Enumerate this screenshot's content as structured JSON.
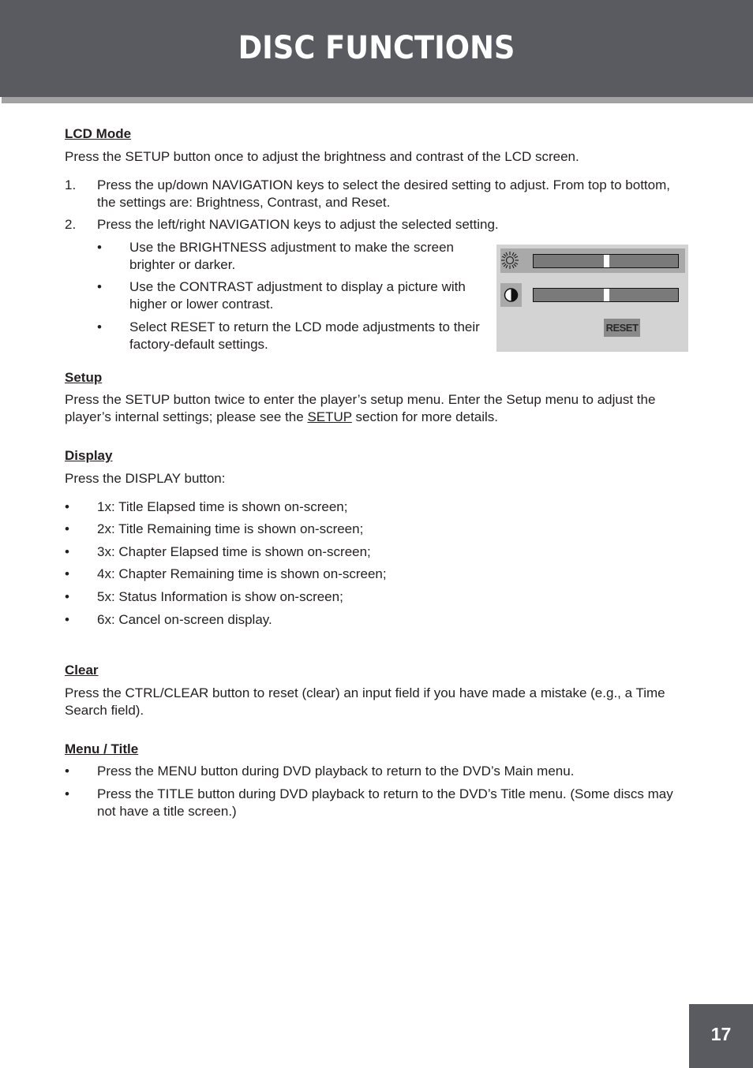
{
  "header": {
    "title": "DISC FUNCTIONS"
  },
  "lcd_mode": {
    "heading": "LCD Mode",
    "intro": "Press the SETUP button once to adjust the brightness and contrast of the LCD screen.",
    "steps": [
      {
        "num": "1.",
        "text": "Press the up/down NAVIGATION keys to select the desired setting to adjust. From top to bottom, the settings are: Brightness, Contrast, and Reset."
      },
      {
        "num": "2.",
        "text": "Press the left/right NAVIGATION keys to adjust the selected setting."
      }
    ],
    "bullets": [
      {
        "mark": "•",
        "text": "Use the BRIGHTNESS adjustment to make the screen brighter or darker."
      },
      {
        "mark": "•",
        "text": "Use the CONTRAST adjustment to display a picture with higher or lower contrast."
      },
      {
        "mark": "•",
        "text": "Select RESET to return the LCD mode adjustments to their factory-default settings."
      }
    ],
    "osd": {
      "brightness_icon": "sun-icon",
      "contrast_icon": "contrast-icon",
      "brightness_level": 0.5,
      "contrast_level": 0.5,
      "reset_label": "RESET"
    }
  },
  "setup": {
    "heading": "Setup",
    "text_before": "Press the SETUP button twice to enter the player’s setup menu. Enter the Setup menu to adjust the player’s internal settings; please see the ",
    "link": "SETUP",
    "text_after": " section for more details."
  },
  "display": {
    "heading": "Display",
    "intro": "Press the DISPLAY button:",
    "items": [
      {
        "mark": "•",
        "text": "1x: Title Elapsed time is shown on-screen;"
      },
      {
        "mark": "•",
        "text": "2x: Title Remaining time is shown on-screen;"
      },
      {
        "mark": "•",
        "text": "3x: Chapter Elapsed time is shown on-screen;"
      },
      {
        "mark": "•",
        "text": "4x: Chapter Remaining time is shown on-screen;"
      },
      {
        "mark": "•",
        "text": "5x: Status Information is show on-screen;"
      },
      {
        "mark": "•",
        "text": "6x: Cancel on-screen display."
      }
    ]
  },
  "clear": {
    "heading": "Clear",
    "text": "Press the CTRL/CLEAR button to reset (clear) an input field if you have made a mistake (e.g., a Time Search field)."
  },
  "menu_title": {
    "heading": "Menu / Title",
    "items": [
      {
        "mark": "•",
        "text": "Press the MENU button during DVD playback to return to the DVD’s Main menu."
      },
      {
        "mark": "•",
        "text": "Press the TITLE button during DVD playback to return to the DVD’s Title menu. (Some discs may not have a title screen.)"
      }
    ]
  },
  "page_number": "17"
}
